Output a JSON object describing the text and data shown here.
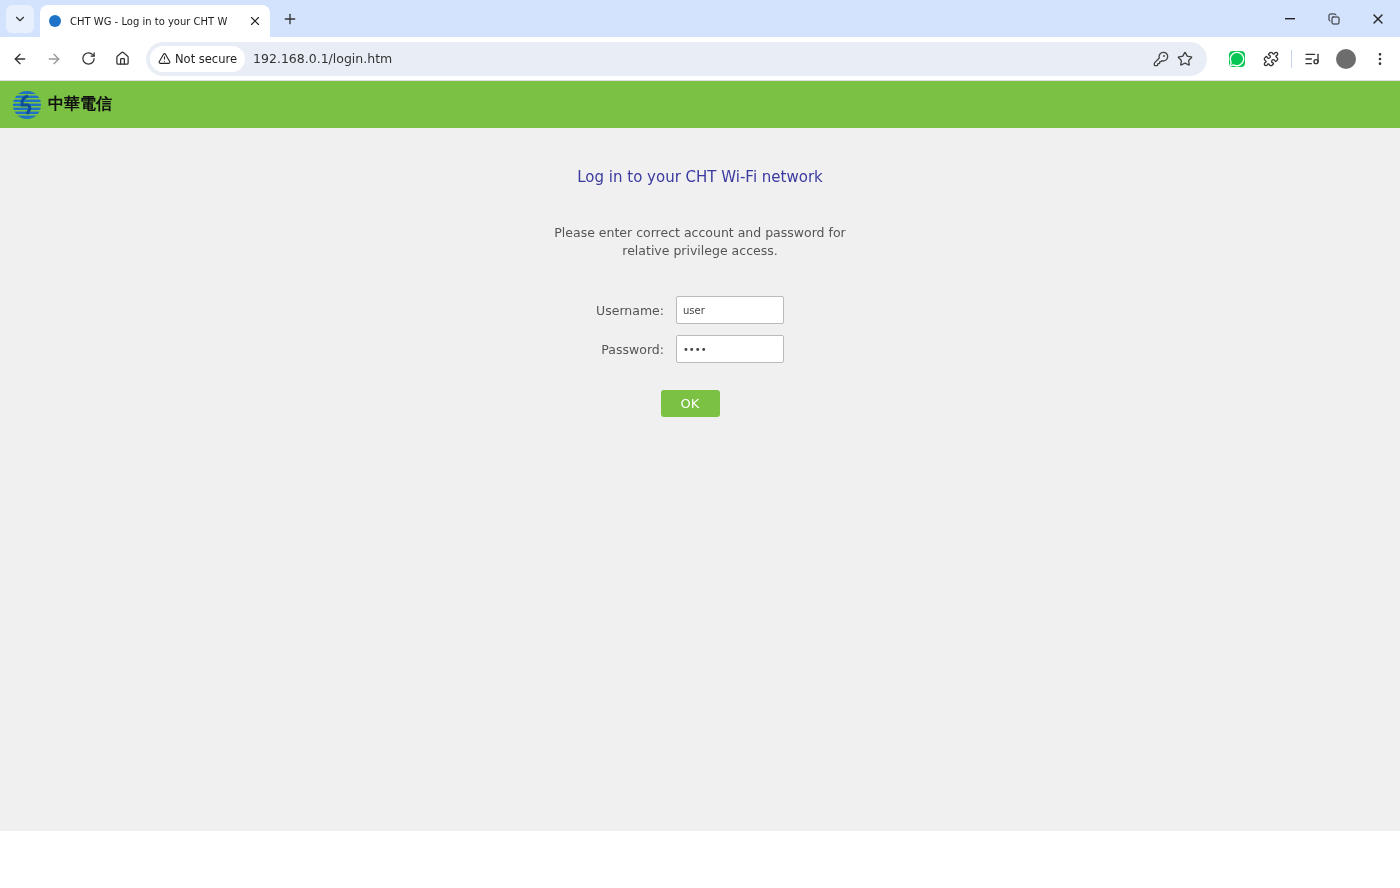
{
  "browser": {
    "tab": {
      "title": "CHT WG - Log in to your CHT W",
      "selected": true
    },
    "security": "Not secure",
    "url": "192.168.0.1/login.htm"
  },
  "header": {
    "brand": "中華電信"
  },
  "login": {
    "title": "Log in to your CHT Wi-Fi network",
    "message": "Please enter correct account and password for relative privilege access.",
    "fields": [
      {
        "label": "Username:",
        "value": "user"
      },
      {
        "label": "Password:",
        "value": "••••"
      }
    ],
    "button": "OK"
  }
}
